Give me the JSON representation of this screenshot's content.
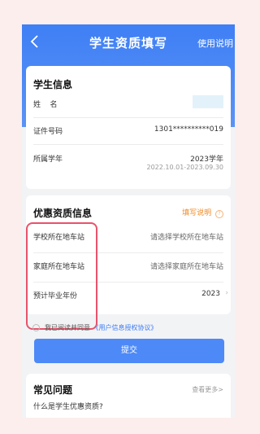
{
  "nav": {
    "back_icon": "chevron-left-icon",
    "title": "学生资质填写",
    "help": "使用说明"
  },
  "student_info": {
    "title": "学生信息",
    "name_label": "姓    名",
    "id_label": "证件号码",
    "id_value": "1301**********019",
    "year_label": "所属学年",
    "year_value": "2023学年",
    "year_range": "2022.10.01-2023.09.30"
  },
  "discount_info": {
    "title": "优惠资质信息",
    "help_label": "填写说明",
    "help_icon": "question-circle-icon",
    "school_station_label": "学校所在地车站",
    "school_station_placeholder": "请选择学校所在地车站",
    "home_station_label": "家庭所在地车站",
    "home_station_placeholder": "请选择家庭所在地车站",
    "grad_year_label": "预计毕业年份",
    "grad_year_value": "2023"
  },
  "agreement": {
    "prefix": "我已阅读并同意",
    "link": "《用户信息授权协议》"
  },
  "submit_label": "提交",
  "faq": {
    "title": "常见问题",
    "more": "查看更多>",
    "q1": "什么是学生优惠资质?"
  },
  "colors": {
    "primary": "#3f7ff5",
    "highlight": "#e8536b",
    "accent": "#f08a24"
  }
}
